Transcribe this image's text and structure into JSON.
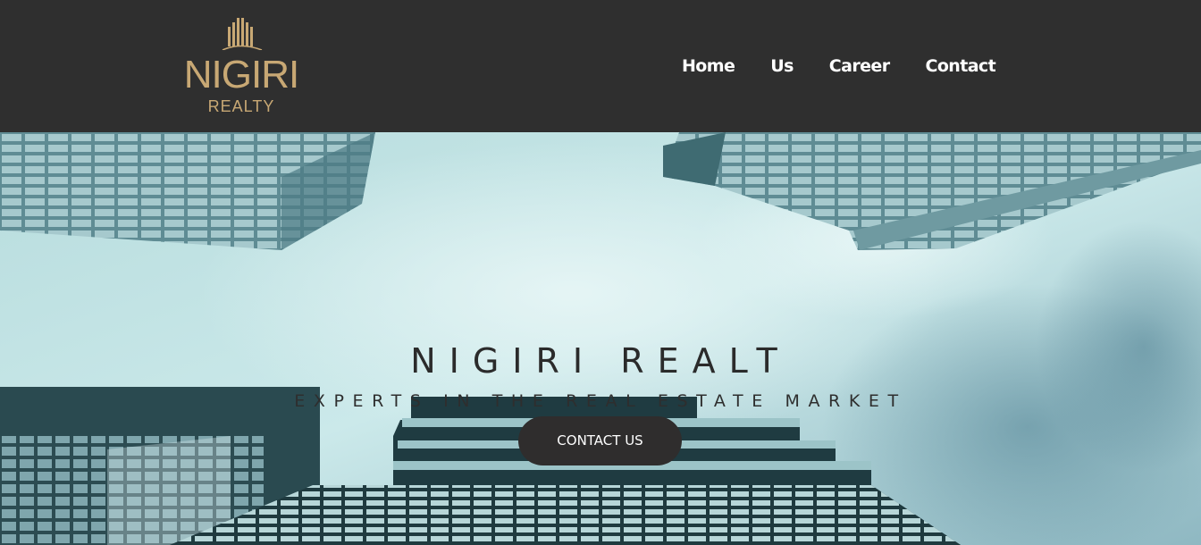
{
  "brand": {
    "name": "NIGIRI",
    "sub": "REALTY",
    "gold": "#c8a874",
    "icon": "building-logo-icon"
  },
  "nav": {
    "items": [
      {
        "label": "Home"
      },
      {
        "label": "Us"
      },
      {
        "label": "Career"
      },
      {
        "label": "Contact"
      }
    ]
  },
  "hero": {
    "title": "NIGIRI REALT",
    "subtitle": "EXPERTS IN THE REAL ESTATE MARKET",
    "cta_label": "CONTACT US"
  },
  "colors": {
    "header_bg": "#2f2f2f",
    "button_bg": "#2f2d2d",
    "text_light": "#ffffff"
  }
}
